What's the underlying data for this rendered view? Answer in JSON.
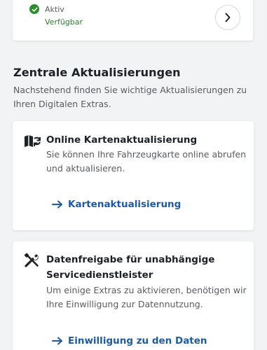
{
  "status": {
    "label": "Aktiv",
    "availability": "Verfügbar",
    "icon": "check-circle-icon",
    "color": "#2e8b2e"
  },
  "section": {
    "title": "Zentrale Aktualisierungen",
    "description": "Nachstehend finden Sie wichtige Aktualisierungen zu Ihren Digitalen Extras."
  },
  "cards": [
    {
      "icon": "map-sync-icon",
      "title": "Online Kartenaktualisierung",
      "text": "Sie können Ihre Fahrzeugkarte online abrufen und aktualisieren.",
      "link": "Kartenaktualisierung"
    },
    {
      "icon": "tools-icon",
      "title": "Datenfreigabe für unabhängige Servicedienstleister",
      "text": "Um einige Extras zu aktivieren, benötigen wir Ihre Einwilligung zur Datennutzung.",
      "link": "Einwilligung zu den Daten"
    }
  ],
  "colors": {
    "link": "#1f5aa6",
    "background": "#f2f3f4"
  }
}
